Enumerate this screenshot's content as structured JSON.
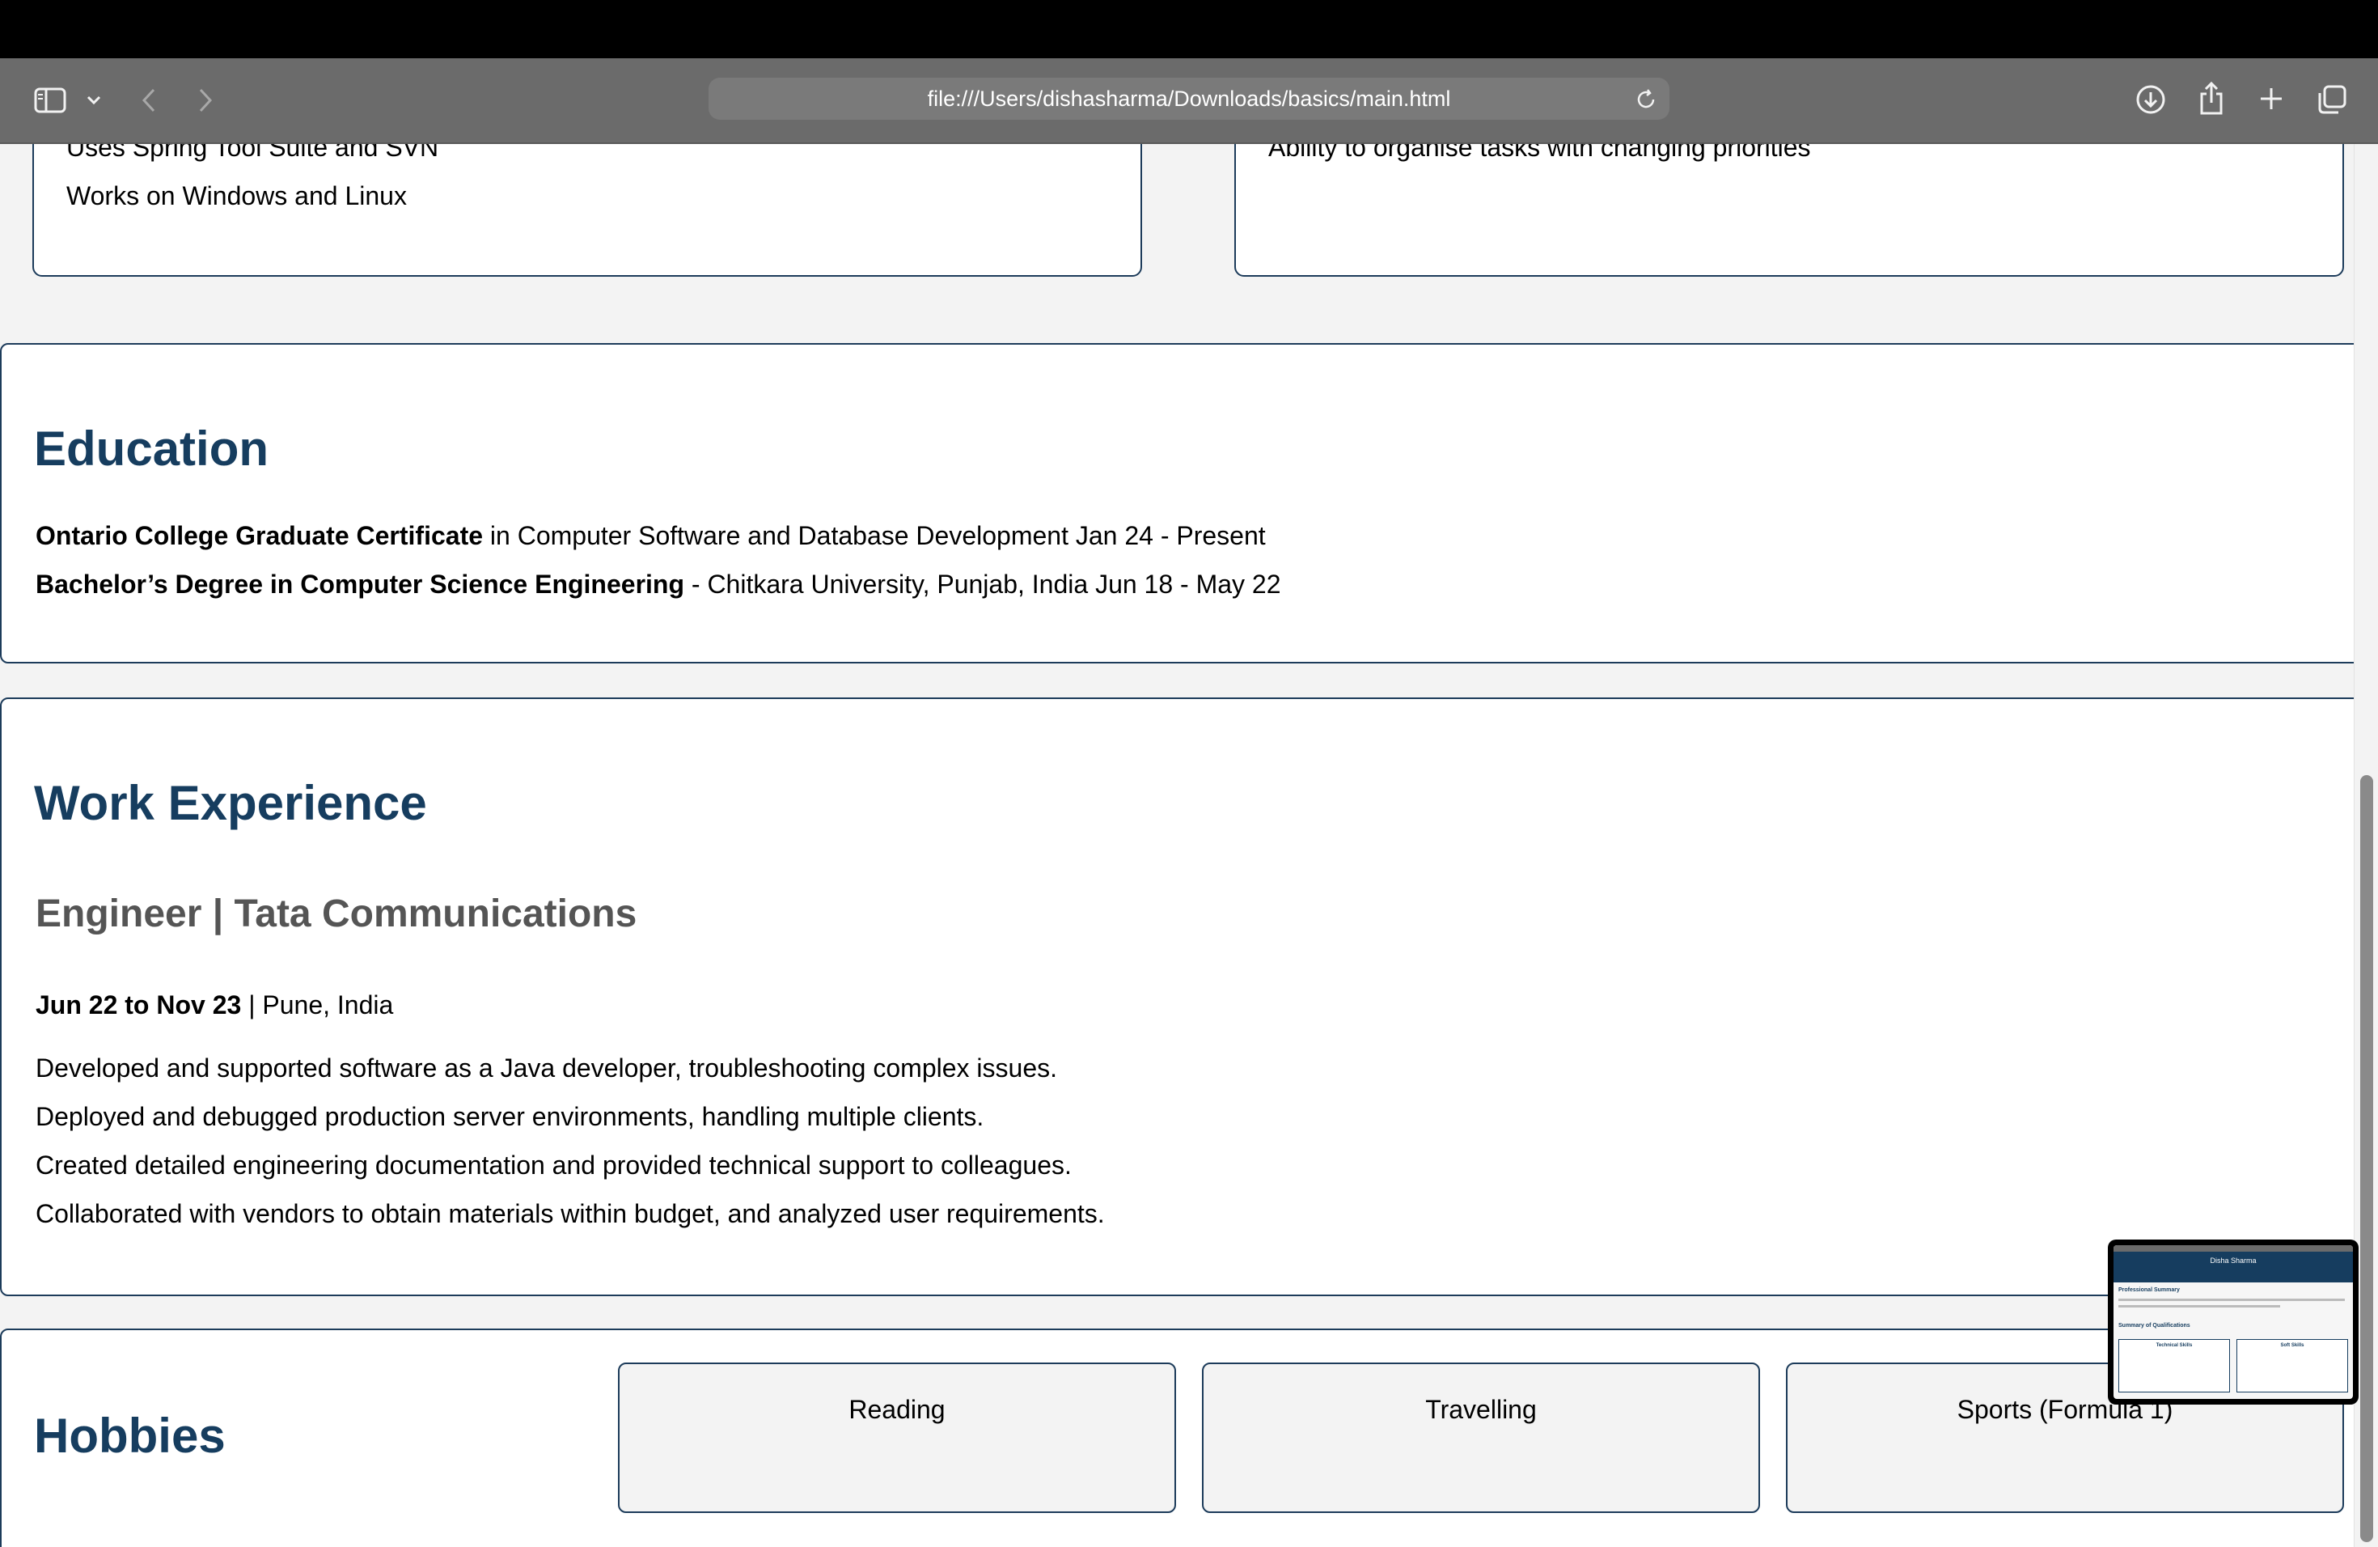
{
  "browser": {
    "url": "file:///Users/dishasharma/Downloads/basics/main.html"
  },
  "skills": {
    "left_lines": [
      "Uses Spring Tool Suite and SVN",
      "Works on Windows and Linux"
    ],
    "right_lines": [
      "Ability to organise tasks with changing priorities"
    ]
  },
  "education": {
    "title": "Education",
    "items": [
      {
        "bold": "Ontario College Graduate Certificate",
        "rest": " in Computer Software and Database Development Jan 24 - Present"
      },
      {
        "bold": "Bachelor’s Degree in Computer Science Engineering",
        "rest": " - Chitkara University, Punjab, India Jun 18 - May 22"
      }
    ]
  },
  "work": {
    "title": "Work Experience",
    "job_title": "Engineer | Tata Communications",
    "dates": "Jun 22 to Nov 23",
    "location": " | Pune, India",
    "duties": [
      "Developed and supported software as a Java developer, troubleshooting complex issues.",
      "Deployed and debugged production server environments, handling multiple clients.",
      "Created detailed engineering documentation and provided technical support to colleagues.",
      "Collaborated with vendors to obtain materials within budget, and analyzed user requirements."
    ]
  },
  "hobbies": {
    "title": "Hobbies",
    "items": [
      "Reading",
      "Travelling",
      "Sports (Formula 1)"
    ]
  },
  "thumbnail": {
    "name": "Disha Sharma",
    "section1": "Professional Summary",
    "section2": "Summary of Qualifications",
    "col1": "Technical Skills",
    "col2": "Soft Skills"
  },
  "icons": {
    "sidebar": "sidebar-icon",
    "chevron": "chevron-down-icon",
    "back": "back-icon",
    "forward": "forward-icon",
    "reload": "reload-icon",
    "download": "download-icon",
    "share": "share-icon",
    "new_tab": "plus-icon",
    "tabs": "tabs-overview-icon"
  },
  "colors": {
    "accent": "#163d5f",
    "toolbar": "#6b6b6b"
  }
}
